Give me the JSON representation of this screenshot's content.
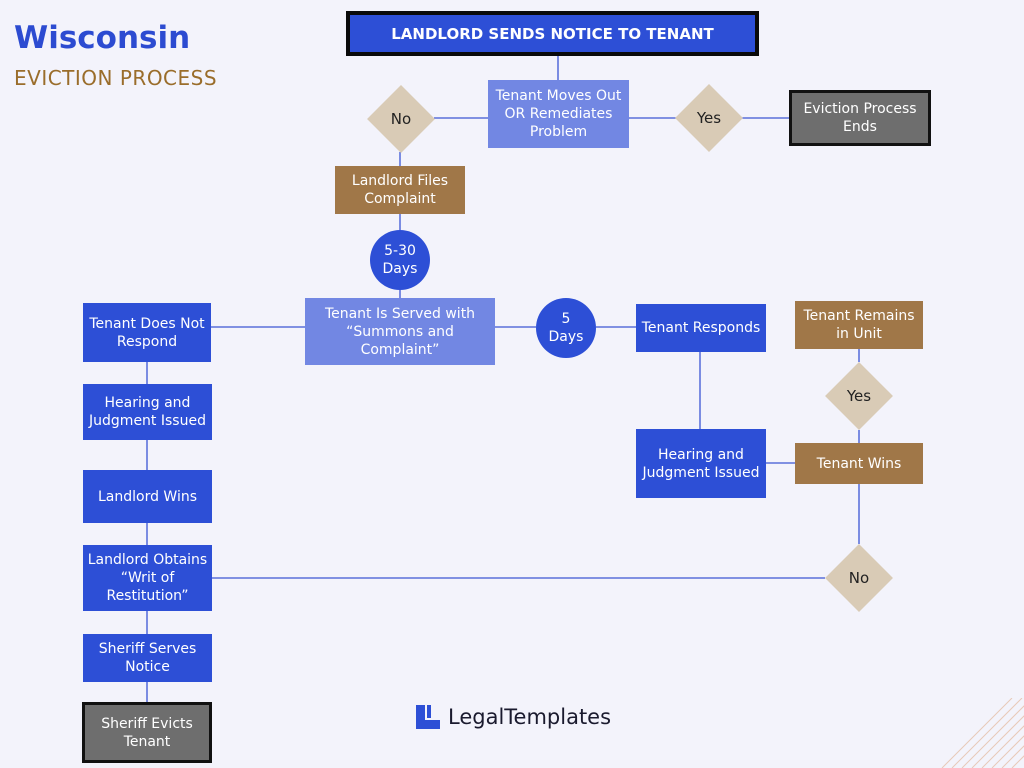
{
  "header": {
    "title": "Wisconsin",
    "subtitle": "EVICTION PROCESS"
  },
  "colors": {
    "primary_blue": "#2d4fd6",
    "light_blue": "#7287e3",
    "brown": "#a07748",
    "gray_end": "#6e6e6e",
    "diamond": "#d9cbb6",
    "background": "#f3f3fb",
    "title_blue": "#2c4bd1",
    "subtitle_brown": "#9a6d2b"
  },
  "nodes": {
    "start": "LANDLORD SENDS NOTICE TO TENANT",
    "moves_out": "Tenant Moves Out OR Remediates Problem",
    "decision_no_top": "No",
    "decision_yes_top": "Yes",
    "process_ends": "Eviction Process Ends",
    "files_complaint": "Landlord Files Complaint",
    "days_5_30": "5-30 Days",
    "served": "Tenant Is Served with “Summons and Complaint”",
    "days_5": "5 Days",
    "does_not_respond": "Tenant Does Not Respond",
    "responds": "Tenant Responds",
    "hearing_left": "Hearing and Judgment Issued",
    "hearing_right": "Hearing and Judgment Issued",
    "landlord_wins": "Landlord Wins",
    "tenant_wins": "Tenant Wins",
    "remains": "Tenant Remains in Unit",
    "decision_yes_right": "Yes",
    "decision_no_right": "No",
    "writ": "Landlord Obtains “Writ of Restitution”",
    "sheriff_notice": "Sheriff Serves Notice",
    "sheriff_evicts": "Sheriff Evicts Tenant"
  },
  "footer": {
    "brand": "LegalTemplates"
  }
}
